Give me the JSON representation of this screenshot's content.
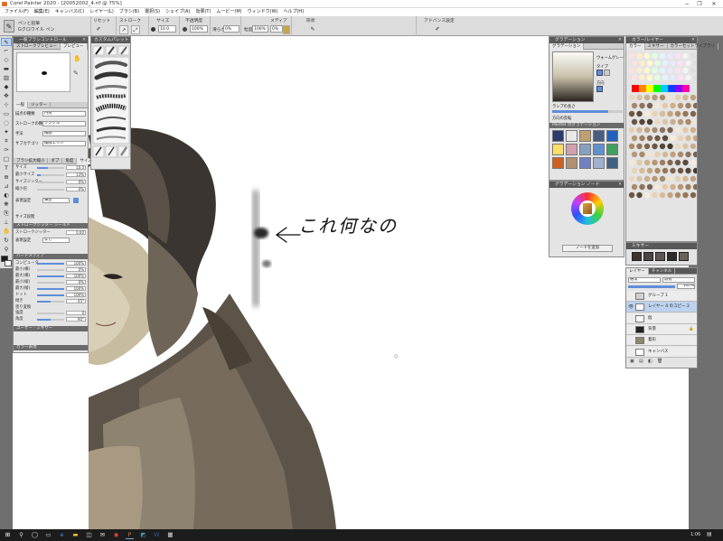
{
  "window": {
    "title": "Corel Painter 2020 - [20052002_4.rif @ 75%]",
    "controls": [
      "−",
      "❐",
      "✕"
    ]
  },
  "menu": [
    "ファイル(F)",
    "編集(E)",
    "キャンバス(C)",
    "レイヤー(L)",
    "ブラシ(B)",
    "選択(S)",
    "シェイプ(A)",
    "効果(T)",
    "ムービー(M)",
    "ウィンドウ(W)",
    "ヘルプ(H)"
  ],
  "property_bar": {
    "brush_category": "ペンと鉛筆",
    "brush_variant": "Gクロウイル ペン",
    "reset_label": "リセット",
    "stroke_label": "ストローク",
    "size_label": "サイズ",
    "size_value": "10.0",
    "opacity_label": "不透明度",
    "opacity_value": "100%",
    "smoothing_label": "滑らかさ",
    "smoothing_value": "0%",
    "media_label": "メディア",
    "grain_label": "粒度",
    "grain_value": "100%",
    "grain2_value": "0%",
    "shape_label": "形状",
    "advanced_label": "アドバンス設定"
  },
  "tools": [
    {
      "icon": "brush-icon",
      "glyph": "✎",
      "selected": true
    },
    {
      "icon": "dropper-icon",
      "glyph": "⌐"
    },
    {
      "icon": "eraser-icon",
      "glyph": "◇"
    },
    {
      "icon": "fill-icon",
      "glyph": "▬"
    },
    {
      "icon": "gradient-icon",
      "glyph": "▥"
    },
    {
      "icon": "blend-icon",
      "glyph": "◆"
    },
    {
      "icon": "layer-adjust-icon",
      "glyph": "✥"
    },
    {
      "icon": "transform-icon",
      "glyph": "⊹"
    },
    {
      "icon": "rect-select-icon",
      "glyph": "▭"
    },
    {
      "icon": "lasso-icon",
      "glyph": "◌"
    },
    {
      "icon": "magic-wand-icon",
      "glyph": "✦"
    },
    {
      "icon": "crop-icon",
      "glyph": "⌗"
    },
    {
      "icon": "pen-shape-icon",
      "glyph": "✑"
    },
    {
      "icon": "rect-shape-icon",
      "glyph": "□"
    },
    {
      "icon": "text-icon",
      "glyph": "T"
    },
    {
      "icon": "divine-icon",
      "glyph": "⊕"
    },
    {
      "icon": "perspective-icon",
      "glyph": "⊿"
    },
    {
      "icon": "mirror-icon",
      "glyph": "◐"
    },
    {
      "icon": "kaleidoscope-icon",
      "glyph": "❋"
    },
    {
      "icon": "cloner-icon",
      "glyph": "⎘"
    },
    {
      "icon": "rubber-stamp-icon",
      "glyph": "⊥"
    },
    {
      "icon": "grabber-icon",
      "glyph": "✋"
    },
    {
      "icon": "rotate-icon",
      "glyph": "↻"
    },
    {
      "icon": "magnifier-icon",
      "glyph": "⚲"
    }
  ],
  "colors": {
    "main": "#1b1b1b",
    "additional": "#ffffff",
    "accent_blue": "#5f8ed8"
  },
  "brush_control_panel": {
    "title": "一般ブラシコントロール",
    "tabs": [
      "ストロークプレビュー",
      "プレビュー"
    ],
    "general_tabs": [
      "一般",
      "ジッター"
    ],
    "rows": [
      {
        "label": "描点の種類",
        "value": "円形"
      },
      {
        "label": "ストロークの種類",
        "value": "シングル"
      },
      {
        "label": "手法",
        "value": "描画"
      },
      {
        "label": "サブカテゴリ",
        "value": "描画エッジ"
      }
    ],
    "size_tabs": [
      "ブラシ拡大縮小",
      "ダブ",
      "角度",
      "サイズ"
    ],
    "size_rows": [
      {
        "label": "サイズ",
        "value": "10.0",
        "level": 0.4
      },
      {
        "label": "最小サイズ",
        "value": "13%",
        "level": 0.13
      },
      {
        "label": "サイズジッター",
        "value": "0%",
        "level": 0
      },
      {
        "label": "縮小倍",
        "value": "0%",
        "level": 0
      }
    ],
    "expression_label": "表現設定",
    "expression_value": "筆圧",
    "size_step_label": "サイズ段階",
    "stroke_jitter_title": "ストロークジッター",
    "stroke_jitter_tab": "シールド",
    "stroke_jitter_row": "ストロークジッター",
    "stroke_jitter_value": "0.00",
    "expression2_label": "表現設定",
    "expression2_value": "なし",
    "hard_media_title": "ハードメディア",
    "hard_media_rows": [
      {
        "label": "コンピュータ",
        "value": "100%",
        "level": 1
      },
      {
        "label": "最小(横)",
        "value": "0%",
        "level": 0
      },
      {
        "label": "最大(横)",
        "value": "100%",
        "level": 1
      },
      {
        "label": "最小(縦)",
        "value": "0%",
        "level": 0
      },
      {
        "label": "最大(縦)",
        "value": "100%",
        "level": 1
      },
      {
        "label": "ドット",
        "value": "100%",
        "level": 1
      },
      {
        "label": "傾き",
        "value": "45°",
        "level": 0.5
      }
    ],
    "dip_label": "塗り変換",
    "dip_rows": [
      {
        "label": "強度",
        "value": "0",
        "level": 0
      },
      {
        "label": "角度",
        "value": "90°",
        "level": 0.5
      }
    ],
    "footer_tabs": [
      "ユーザー",
      "ミキサー"
    ],
    "color_variability": "カラー表現"
  },
  "dab_panel": {
    "title": "カスタムパレット"
  },
  "gradation_panel": {
    "title": "グラデーション",
    "tab": "グラデーション",
    "ramp_label": "ランプの長さ",
    "rows": [
      "ウォームグレー",
      "タイプ",
      "方向"
    ],
    "reverse_label": "方向の反転",
    "library_label": "Painter のグラデーション",
    "lib_swatches": [
      "#2a3a6a",
      "#e8e8e8",
      "#bfa070",
      "#4a5d80",
      "#2060c0",
      "#ffdd66",
      "#d0a0b0",
      "#88a0c0",
      "#6090d0",
      "#40a060",
      "#d06020",
      "#b09070",
      "#7080c0",
      "#a0b0d0",
      "#406080"
    ]
  },
  "gradation_node_panel": {
    "title": "グラデーション ノード",
    "button": "ノードを追加"
  },
  "color_panel": {
    "title": "カラー/レイヤー",
    "tabs": [
      "カラー",
      "ミキサー",
      "カラーセットライブラリ"
    ],
    "spectrum": [
      "#ff0000",
      "#ff8800",
      "#ffff00",
      "#00ff00",
      "#00ccff",
      "#0044ff",
      "#8800ff",
      "#ff00aa"
    ],
    "mixer_swatches": [
      "#3b3431",
      "#4d4542",
      "#5c5551",
      "#2e2926",
      "#6a625d"
    ]
  },
  "mixer_label": "ミキサー",
  "layers_panel": {
    "tabs": [
      "レイヤー",
      "チャンネル"
    ],
    "composite": "通常",
    "composite2": "無視",
    "opacity": "100%",
    "layers": [
      {
        "name": "グループ 1",
        "eye": "",
        "thumb": "#d0d0d0",
        "lock": "",
        "selected": false
      },
      {
        "name": "レイヤー 4 のコピー 2",
        "eye": "👁",
        "thumb": "#ffffff",
        "lock": "",
        "selected": true
      },
      {
        "name": "仮",
        "eye": "",
        "thumb": "#f8f8f8",
        "lock": "",
        "selected": false
      },
      {
        "name": "背景",
        "eye": "",
        "thumb": "#222222",
        "lock": "🔒",
        "selected": false
      },
      {
        "name": "着彩",
        "eye": "",
        "thumb": "#8a8a6a",
        "lock": "",
        "selected": false
      },
      {
        "name": "キャンバス",
        "eye": "",
        "thumb": "#ffffff",
        "lock": "",
        "selected": false
      }
    ],
    "footer_icons": [
      "layer-new-icon",
      "layer-group-icon",
      "layer-mask-icon",
      "layer-delete-icon"
    ]
  },
  "canvas": {
    "annotation": "これ何なの"
  },
  "taskbar": {
    "icons": [
      "windows-icon",
      "search-icon",
      "cortana-icon",
      "task-view-icon",
      "edge-icon",
      "explorer-icon",
      "store-icon",
      "mail-icon",
      "chrome-icon",
      "painter-icon",
      "photo-icon",
      "word-icon",
      "misc-icon"
    ],
    "clock": "1:06"
  }
}
